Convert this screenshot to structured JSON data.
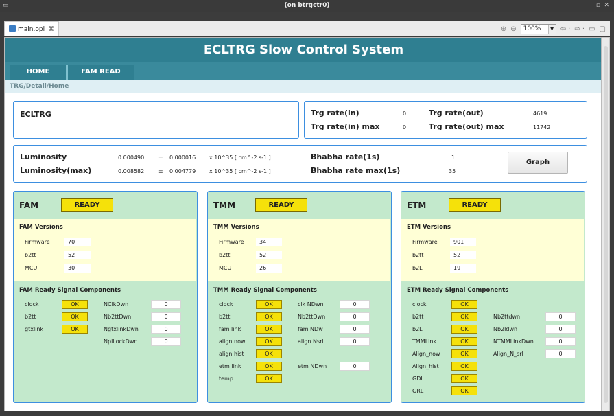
{
  "window": {
    "title": "(on btrgctr0)",
    "menu_glyph": "▭",
    "minimize_glyph": "▫",
    "close_glyph": "✕"
  },
  "tab": {
    "file": "main.opi",
    "close_glyph": "⌘"
  },
  "toolbar": {
    "zoom_in": "⊕",
    "zoom_out": "⊖",
    "zoom": "100%",
    "back": "⇦ ·",
    "forward": "⇨ ·",
    "minimize": "▭",
    "maximize": "▢"
  },
  "header": {
    "title": "ECLTRG Slow Control System"
  },
  "nav": {
    "home": "HOME",
    "fam_read": "FAM READ"
  },
  "breadcrumb": "TRG/Detail/Home",
  "ecltrg": {
    "label": "ECLTRG"
  },
  "rates": {
    "in_label": "Trg rate(in)",
    "in_value": "0",
    "out_label": "Trg rate(out)",
    "out_value": "4619",
    "in_max_label": "Trg rate(in) max",
    "in_max_value": "0",
    "out_max_label": "Trg rate(out) max",
    "out_max_value": "11742"
  },
  "lumi": {
    "label": "Luminosity",
    "value": "0.000490",
    "pm": "±",
    "err": "0.000016",
    "unit": "x 10^35 [ cm^-2 s-1 ]",
    "max_label": "Luminosity(max)",
    "max_value": "0.008582",
    "max_err": "0.004779",
    "bhabha_label": "Bhabha rate(1s)",
    "bhabha_value": "1",
    "bhabha_max_label": "Bhabha rate max(1s)",
    "bhabha_max_value": "35",
    "graph_button": "Graph"
  },
  "fam": {
    "name": "FAM",
    "status": "READY",
    "versions_title": "FAM Versions",
    "versions": [
      {
        "label": "Firmware",
        "value": "70"
      },
      {
        "label": "b2tt",
        "value": "52"
      },
      {
        "label": "MCU",
        "value": "30"
      }
    ],
    "signals_title": "FAM Ready Signal Components",
    "signals": [
      {
        "label": "clock",
        "value": "OK"
      },
      {
        "label": "b2tt",
        "value": "OK"
      },
      {
        "label": "gtxlink",
        "value": "OK"
      }
    ],
    "counters": [
      {
        "label": "NClkDwn",
        "value": "0"
      },
      {
        "label": "Nb2ttDwn",
        "value": "0"
      },
      {
        "label": "NgtxlinkDwn",
        "value": "0"
      },
      {
        "label": "NplllockDwn",
        "value": "0"
      }
    ]
  },
  "tmm": {
    "name": "TMM",
    "status": "READY",
    "versions_title": "TMM Versions",
    "versions": [
      {
        "label": "Firmware",
        "value": "34"
      },
      {
        "label": "b2tt",
        "value": "52"
      },
      {
        "label": "MCU",
        "value": "26"
      }
    ],
    "signals_title": "TMM Ready Signal Components",
    "signals": [
      {
        "label": "clock",
        "value": "OK"
      },
      {
        "label": "b2tt",
        "value": "OK"
      },
      {
        "label": "fam link",
        "value": "OK"
      },
      {
        "label": "align now",
        "value": "OK"
      },
      {
        "label": "align hist",
        "value": "OK"
      },
      {
        "label": "etm link",
        "value": "OK"
      },
      {
        "label": "temp.",
        "value": "OK"
      }
    ],
    "counters": [
      {
        "label": "clk NDwn",
        "value": "0"
      },
      {
        "label": "Nb2ttDwn",
        "value": "0"
      },
      {
        "label": "fam NDw",
        "value": "0"
      },
      {
        "label": "align Nsrl",
        "value": "0"
      },
      {
        "label": "etm NDwn",
        "value": "0"
      }
    ]
  },
  "etm": {
    "name": "ETM",
    "status": "READY",
    "versions_title": "ETM Versions",
    "versions": [
      {
        "label": "Firmware",
        "value": "901"
      },
      {
        "label": "b2tt",
        "value": "52"
      },
      {
        "label": "b2L",
        "value": "19"
      }
    ],
    "signals_title": "ETM Ready Signal Components",
    "signals": [
      {
        "label": "clock",
        "value": "OK"
      },
      {
        "label": "b2tt",
        "value": "OK"
      },
      {
        "label": "b2L",
        "value": "OK"
      },
      {
        "label": "TMMLink",
        "value": "OK"
      },
      {
        "label": "Align_now",
        "value": "OK"
      },
      {
        "label": "Align_hist",
        "value": "OK"
      },
      {
        "label": "GDL",
        "value": "OK"
      },
      {
        "label": "GRL",
        "value": "OK"
      }
    ],
    "counters": [
      {
        "label": "Nb2ttdwn",
        "value": "0"
      },
      {
        "label": "Nb2ldwn",
        "value": "0"
      },
      {
        "label": "NTMMLinkDwn",
        "value": "0"
      },
      {
        "label": "Align_N_srl",
        "value": "0"
      }
    ]
  },
  "colors": {
    "header": "#2f7f91",
    "panel": "#c3e9cc",
    "versions_bg": "#ffffd6",
    "status_yellow": "#f5e10a",
    "border_blue": "#3d8fe0"
  }
}
